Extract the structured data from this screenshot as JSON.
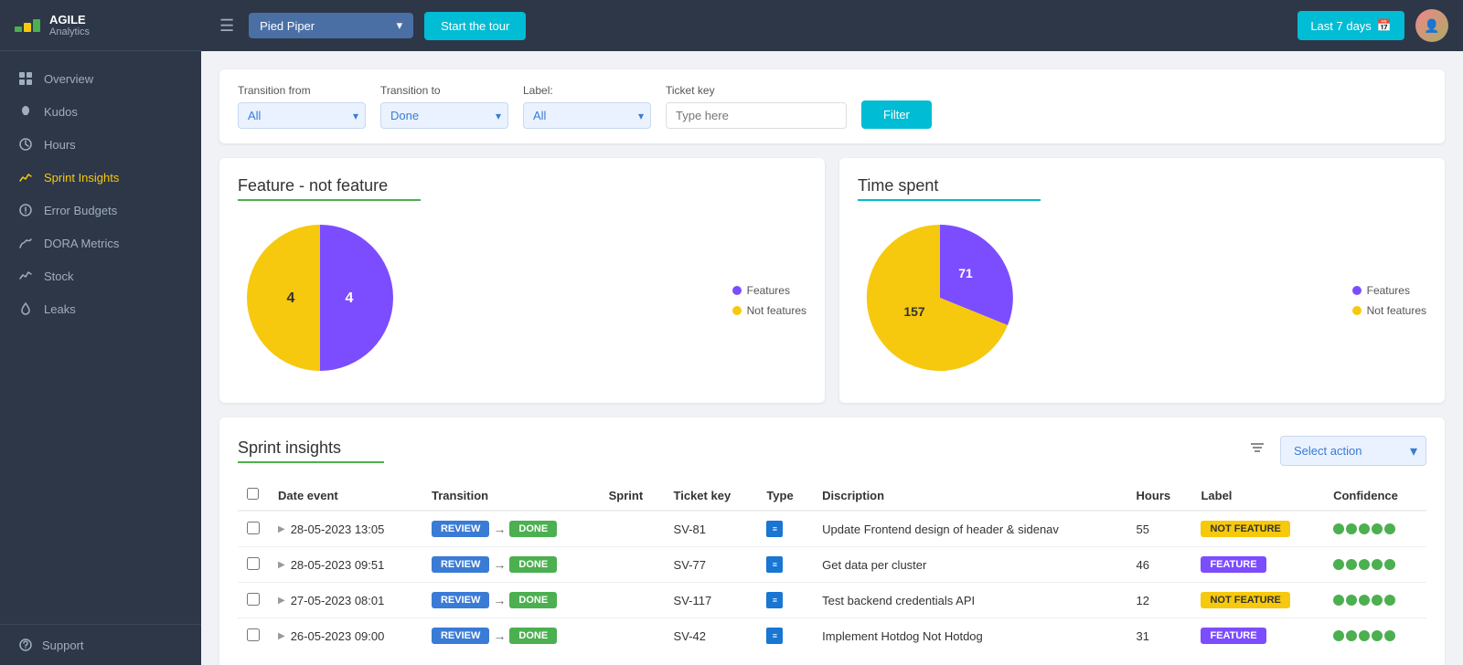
{
  "sidebar": {
    "logo": {
      "title": "AGILE",
      "subtitle": "Analytics"
    },
    "nav": [
      {
        "id": "overview",
        "label": "Overview",
        "active": false
      },
      {
        "id": "kudos",
        "label": "Kudos",
        "active": false
      },
      {
        "id": "hours",
        "label": "Hours",
        "active": false
      },
      {
        "id": "sprint-insights",
        "label": "Sprint Insights",
        "active": true
      },
      {
        "id": "error-budgets",
        "label": "Error Budgets",
        "active": false
      },
      {
        "id": "dora-metrics",
        "label": "DORA Metrics",
        "active": false
      },
      {
        "id": "stock",
        "label": "Stock",
        "active": false
      },
      {
        "id": "leaks",
        "label": "Leaks",
        "active": false
      }
    ],
    "support_label": "Support"
  },
  "header": {
    "company_name": "Pied Piper",
    "start_tour_label": "Start the tour",
    "last_days_label": "Last 7 days",
    "hamburger_label": "☰"
  },
  "filters": {
    "transition_from_label": "Transition from",
    "transition_from_value": "All",
    "transition_to_label": "Transition to",
    "transition_to_value": "Done",
    "label_label": "Label:",
    "label_value": "All",
    "ticket_key_label": "Ticket key",
    "ticket_key_placeholder": "Type here",
    "filter_btn_label": "Filter"
  },
  "feature_chart": {
    "title": "Feature - not feature",
    "features_count": 4,
    "not_features_count": 4,
    "features_label": "Features",
    "not_features_label": "Not features",
    "features_color": "#7c4dff",
    "not_features_color": "#f6c90e"
  },
  "time_spent_chart": {
    "title": "Time spent",
    "features_hours": 71,
    "not_features_hours": 157,
    "features_label": "Features",
    "not_features_label": "Not features",
    "features_color": "#7c4dff",
    "not_features_color": "#f6c90e"
  },
  "table": {
    "title": "Sprint insights",
    "select_action_label": "Select action",
    "columns": [
      "Date event",
      "Transition",
      "Sprint",
      "Ticket key",
      "Type",
      "Discription",
      "Hours",
      "Label",
      "Confidence"
    ],
    "rows": [
      {
        "date": "28-05-2023 13:05",
        "transition_from": "REVIEW",
        "transition_to": "DONE",
        "sprint": "",
        "ticket_key": "SV-81",
        "type": "task",
        "description": "Update Frontend design of header & sidenav",
        "hours": 55,
        "label": "NOT FEATURE",
        "label_type": "not-feature",
        "confidence": 5
      },
      {
        "date": "28-05-2023 09:51",
        "transition_from": "REVIEW",
        "transition_to": "DONE",
        "sprint": "",
        "ticket_key": "SV-77",
        "type": "task",
        "description": "Get data per cluster",
        "hours": 46,
        "label": "FEATURE",
        "label_type": "feature",
        "confidence": 5
      },
      {
        "date": "27-05-2023 08:01",
        "transition_from": "REVIEW",
        "transition_to": "DONE",
        "sprint": "",
        "ticket_key": "SV-117",
        "type": "task",
        "description": "Test backend credentials API",
        "hours": 12,
        "label": "NOT FEATURE",
        "label_type": "not-feature",
        "confidence": 5
      },
      {
        "date": "26-05-2023 09:00",
        "transition_from": "REVIEW",
        "transition_to": "DONE",
        "sprint": "",
        "ticket_key": "SV-42",
        "type": "task",
        "description": "Implement Hotdog Not Hotdog",
        "hours": 31,
        "label": "FEATURE",
        "label_type": "feature",
        "confidence": 5
      }
    ]
  }
}
